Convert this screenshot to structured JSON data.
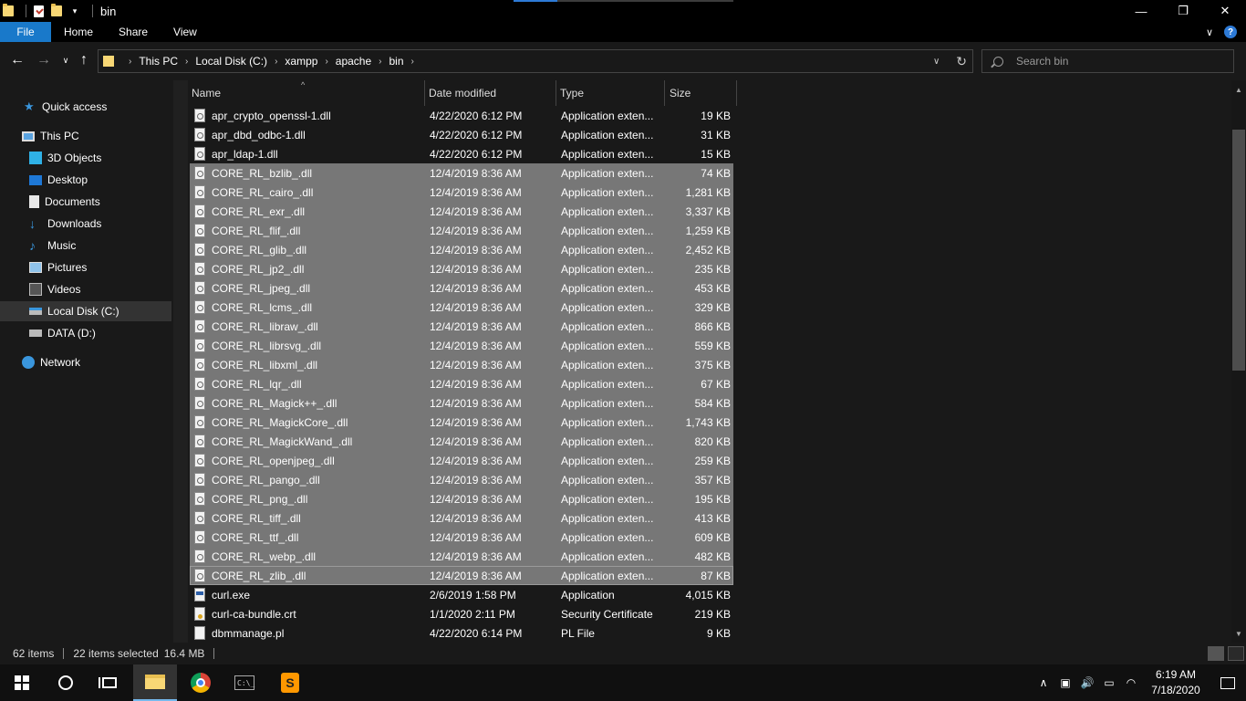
{
  "window": {
    "title": "bin",
    "controls": [
      "—",
      "❐",
      "✕"
    ]
  },
  "ribbon": {
    "tabs": [
      "File",
      "Home",
      "Share",
      "View"
    ]
  },
  "address": {
    "crumbs": [
      "This PC",
      "Local Disk (C:)",
      "xampp",
      "apache",
      "bin"
    ],
    "search_placeholder": "Search bin"
  },
  "nav": {
    "items": [
      {
        "label": "Quick access",
        "icon": "star-icon"
      },
      {
        "label": "This PC",
        "icon": "computer-icon"
      },
      {
        "label": "3D Objects",
        "icon": "cube-icon"
      },
      {
        "label": "Desktop",
        "icon": "desktop-icon"
      },
      {
        "label": "Documents",
        "icon": "document-icon"
      },
      {
        "label": "Downloads",
        "icon": "download-arrow-icon"
      },
      {
        "label": "Music",
        "icon": "music-note-icon"
      },
      {
        "label": "Pictures",
        "icon": "picture-icon"
      },
      {
        "label": "Videos",
        "icon": "film-icon"
      },
      {
        "label": "Local Disk (C:)",
        "icon": "drive-icon"
      },
      {
        "label": "DATA (D:)",
        "icon": "drive-icon"
      },
      {
        "label": "Network",
        "icon": "network-icon"
      }
    ]
  },
  "columns": {
    "name": "Name",
    "date": "Date modified",
    "type": "Type",
    "size": "Size"
  },
  "files": [
    {
      "name": "apr_crypto_openssl-1.dll",
      "date": "4/22/2020 6:12 PM",
      "type": "Application exten...",
      "size": "19 KB",
      "kind": "dll",
      "selected": false
    },
    {
      "name": "apr_dbd_odbc-1.dll",
      "date": "4/22/2020 6:12 PM",
      "type": "Application exten...",
      "size": "31 KB",
      "kind": "dll",
      "selected": false
    },
    {
      "name": "apr_ldap-1.dll",
      "date": "4/22/2020 6:12 PM",
      "type": "Application exten...",
      "size": "15 KB",
      "kind": "dll",
      "selected": false
    },
    {
      "name": "CORE_RL_bzlib_.dll",
      "date": "12/4/2019 8:36 AM",
      "type": "Application exten...",
      "size": "74 KB",
      "kind": "dll",
      "selected": true
    },
    {
      "name": "CORE_RL_cairo_.dll",
      "date": "12/4/2019 8:36 AM",
      "type": "Application exten...",
      "size": "1,281 KB",
      "kind": "dll",
      "selected": true
    },
    {
      "name": "CORE_RL_exr_.dll",
      "date": "12/4/2019 8:36 AM",
      "type": "Application exten...",
      "size": "3,337 KB",
      "kind": "dll",
      "selected": true
    },
    {
      "name": "CORE_RL_flif_.dll",
      "date": "12/4/2019 8:36 AM",
      "type": "Application exten...",
      "size": "1,259 KB",
      "kind": "dll",
      "selected": true
    },
    {
      "name": "CORE_RL_glib_.dll",
      "date": "12/4/2019 8:36 AM",
      "type": "Application exten...",
      "size": "2,452 KB",
      "kind": "dll",
      "selected": true
    },
    {
      "name": "CORE_RL_jp2_.dll",
      "date": "12/4/2019 8:36 AM",
      "type": "Application exten...",
      "size": "235 KB",
      "kind": "dll",
      "selected": true
    },
    {
      "name": "CORE_RL_jpeg_.dll",
      "date": "12/4/2019 8:36 AM",
      "type": "Application exten...",
      "size": "453 KB",
      "kind": "dll",
      "selected": true
    },
    {
      "name": "CORE_RL_lcms_.dll",
      "date": "12/4/2019 8:36 AM",
      "type": "Application exten...",
      "size": "329 KB",
      "kind": "dll",
      "selected": true
    },
    {
      "name": "CORE_RL_libraw_.dll",
      "date": "12/4/2019 8:36 AM",
      "type": "Application exten...",
      "size": "866 KB",
      "kind": "dll",
      "selected": true
    },
    {
      "name": "CORE_RL_librsvg_.dll",
      "date": "12/4/2019 8:36 AM",
      "type": "Application exten...",
      "size": "559 KB",
      "kind": "dll",
      "selected": true
    },
    {
      "name": "CORE_RL_libxml_.dll",
      "date": "12/4/2019 8:36 AM",
      "type": "Application exten...",
      "size": "375 KB",
      "kind": "dll",
      "selected": true
    },
    {
      "name": "CORE_RL_lqr_.dll",
      "date": "12/4/2019 8:36 AM",
      "type": "Application exten...",
      "size": "67 KB",
      "kind": "dll",
      "selected": true
    },
    {
      "name": "CORE_RL_Magick++_.dll",
      "date": "12/4/2019 8:36 AM",
      "type": "Application exten...",
      "size": "584 KB",
      "kind": "dll",
      "selected": true
    },
    {
      "name": "CORE_RL_MagickCore_.dll",
      "date": "12/4/2019 8:36 AM",
      "type": "Application exten...",
      "size": "1,743 KB",
      "kind": "dll",
      "selected": true
    },
    {
      "name": "CORE_RL_MagickWand_.dll",
      "date": "12/4/2019 8:36 AM",
      "type": "Application exten...",
      "size": "820 KB",
      "kind": "dll",
      "selected": true
    },
    {
      "name": "CORE_RL_openjpeg_.dll",
      "date": "12/4/2019 8:36 AM",
      "type": "Application exten...",
      "size": "259 KB",
      "kind": "dll",
      "selected": true
    },
    {
      "name": "CORE_RL_pango_.dll",
      "date": "12/4/2019 8:36 AM",
      "type": "Application exten...",
      "size": "357 KB",
      "kind": "dll",
      "selected": true
    },
    {
      "name": "CORE_RL_png_.dll",
      "date": "12/4/2019 8:36 AM",
      "type": "Application exten...",
      "size": "195 KB",
      "kind": "dll",
      "selected": true
    },
    {
      "name": "CORE_RL_tiff_.dll",
      "date": "12/4/2019 8:36 AM",
      "type": "Application exten...",
      "size": "413 KB",
      "kind": "dll",
      "selected": true
    },
    {
      "name": "CORE_RL_ttf_.dll",
      "date": "12/4/2019 8:36 AM",
      "type": "Application exten...",
      "size": "609 KB",
      "kind": "dll",
      "selected": true
    },
    {
      "name": "CORE_RL_webp_.dll",
      "date": "12/4/2019 8:36 AM",
      "type": "Application exten...",
      "size": "482 KB",
      "kind": "dll",
      "selected": true
    },
    {
      "name": "CORE_RL_zlib_.dll",
      "date": "12/4/2019 8:36 AM",
      "type": "Application exten...",
      "size": "87 KB",
      "kind": "dll",
      "selected": true,
      "focused": true
    },
    {
      "name": "curl.exe",
      "date": "2/6/2019 1:58 PM",
      "type": "Application",
      "size": "4,015 KB",
      "kind": "exe",
      "selected": false
    },
    {
      "name": "curl-ca-bundle.crt",
      "date": "1/1/2020 2:11 PM",
      "type": "Security Certificate",
      "size": "219 KB",
      "kind": "crt",
      "selected": false
    },
    {
      "name": "dbmmanage.pl",
      "date": "4/22/2020 6:14 PM",
      "type": "PL File",
      "size": "9 KB",
      "kind": "pl",
      "selected": false
    }
  ],
  "status": {
    "item_count": "62 items",
    "selected": "22 items selected",
    "selected_size": "16.4 MB"
  },
  "taskbar": {
    "time": "6:19 AM",
    "date": "7/18/2020"
  },
  "colors": {
    "selection": "#777777",
    "accent": "#1979ca",
    "background": "#191919"
  }
}
